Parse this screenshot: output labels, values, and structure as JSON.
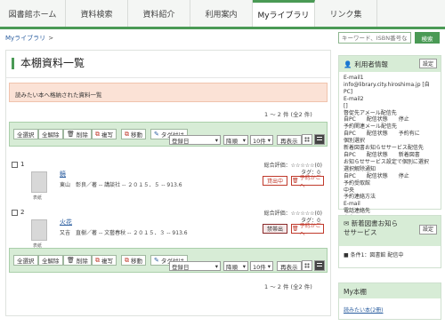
{
  "nav": {
    "tabs": [
      "図書館ホーム",
      "資料検索",
      "資料紹介",
      "利用案内",
      "Myライブラリ",
      "リンク集"
    ]
  },
  "breadcrumb": {
    "current": "Myライブラリ",
    "sep": ">"
  },
  "search": {
    "placeholder": "キーワード、ISBN番号な",
    "button": "検索"
  },
  "main": {
    "title": "本棚資料一覧",
    "notice": "読みたい本へ格納された資料一覧",
    "count_text": "1 ～ 2 件 (全2 件)",
    "toolbar": {
      "select_all": "全選択",
      "deselect_all": "全解除",
      "delete": "削除",
      "copy": "複写",
      "move": "移動",
      "tag": "タグ付け",
      "sort_by": "登録日",
      "order": "降順",
      "per_page": "10件",
      "redisplay": "再表示"
    },
    "items": [
      {
        "num": "1",
        "title": "鏡",
        "meta": "東山　彰良／著 -- 講談社 -- ２０１５．５ -- 913.6",
        "rating": "総合評価：☆☆☆☆☆(0)",
        "tag": "タグ：0",
        "status": "貸出中",
        "reserve": "予約かごへ",
        "cover_label": "表紙"
      },
      {
        "num": "2",
        "title": "火花",
        "meta": "又吉　直樹／著 -- 文藝春秋 -- ２０１５．３ -- 913.6",
        "rating": "総合評価：☆☆☆☆☆(0)",
        "tag": "タグ：0",
        "status": "禁帯出",
        "reserve": "予約かごへ",
        "cover_label": "表紙"
      }
    ]
  },
  "sidebar": {
    "user_info": {
      "title": "利用者情報",
      "settings": "設定",
      "lines": [
        "E-mail1",
        "info@library.city.hiroshima.jp [自PC]",
        "E-mail2",
        "[]",
        "督促先アメール配信先",
        "自PC　　配信状態　　停止",
        "予約関連メール配信先",
        "自PC　　配信状態　　予約有に",
        "個別選択",
        "新着図書お知らせサービス配信先",
        "自PC　　配信状態　　新着図書",
        "お知らせサービス設定で個別に選択",
        "選択解除通知",
        "自PC　　配信状態　　停止",
        "予約受取館",
        "中央",
        "予約連絡方法",
        "E-mail",
        "電話連絡先",
        "自宅"
      ]
    },
    "news": {
      "title_line1": "新着図書お知ら",
      "title_line2": "せサービス",
      "settings": "設定",
      "condition": "条件1：図書館 配信中"
    },
    "my_shelf": {
      "title": "My本棚",
      "link": "読みたい本(2冊)"
    }
  }
}
